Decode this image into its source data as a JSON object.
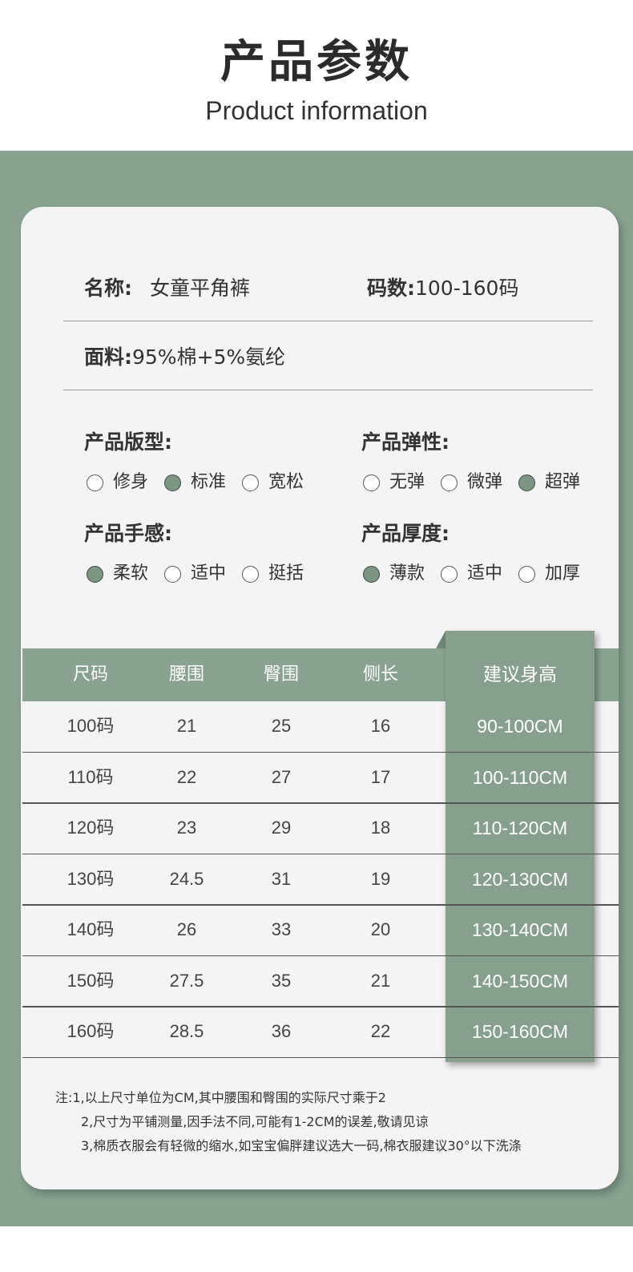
{
  "header": {
    "title_cn": "产品参数",
    "title_en": "Product information"
  },
  "info": {
    "name_label": "名称:",
    "name_value": "女童平角裤",
    "size_label": "码数:",
    "size_value": "100-160码",
    "fabric_label": "面料:",
    "fabric_value": "95%棉+5%氨纶"
  },
  "attributes": {
    "fit": {
      "title": "产品版型:",
      "options": [
        "修身",
        "标准",
        "宽松"
      ],
      "selected": "标准"
    },
    "elasticity": {
      "title": "产品弹性:",
      "options": [
        "无弹",
        "微弹",
        "超弹"
      ],
      "selected": "超弹"
    },
    "feel": {
      "title": "产品手感:",
      "options": [
        "柔软",
        "适中",
        "挺括"
      ],
      "selected": "柔软"
    },
    "thickness": {
      "title": "产品厚度:",
      "options": [
        "薄款",
        "适中",
        "加厚"
      ],
      "selected": "薄款"
    }
  },
  "size_table": {
    "headers": [
      "尺码",
      "腰围",
      "臀围",
      "侧长",
      "建议身高"
    ],
    "rows": [
      [
        "100码",
        "21",
        "25",
        "16",
        "90-100CM"
      ],
      [
        "110码",
        "22",
        "27",
        "17",
        "100-110CM"
      ],
      [
        "120码",
        "23",
        "29",
        "18",
        "110-120CM"
      ],
      [
        "130码",
        "24.5",
        "31",
        "19",
        "120-130CM"
      ],
      [
        "140码",
        "26",
        "33",
        "20",
        "130-140CM"
      ],
      [
        "150码",
        "27.5",
        "35",
        "21",
        "140-150CM"
      ],
      [
        "160码",
        "28.5",
        "36",
        "22",
        "150-160CM"
      ]
    ]
  },
  "notes": [
    "注:1,以上尺寸单位为CM,其中腰围和臀围的实际尺寸乘于2",
    "2,尺寸为平铺测量,因手法不同,可能有1-2CM的误差,敬请见谅",
    "3,棉质衣服会有轻微的缩水,如宝宝偏胖建议选大一码,棉衣服建议30°以下洗涤"
  ],
  "colors": {
    "accent_green": "#89a390",
    "card_bg": "#f4f4f4",
    "selected_radio": "#7c9683"
  }
}
